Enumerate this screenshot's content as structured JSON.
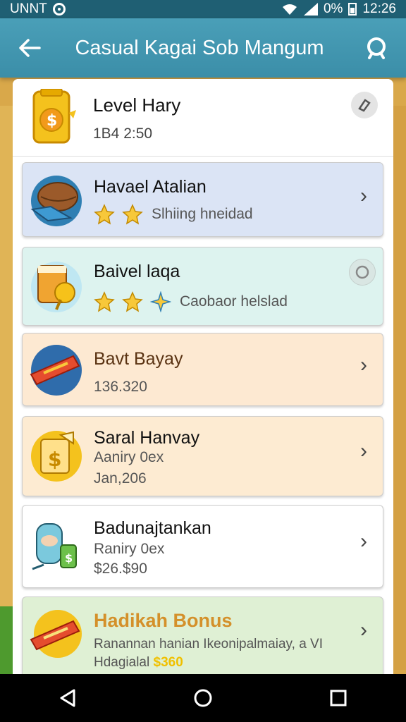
{
  "status": {
    "carrier": "UNNT",
    "battery": "0%",
    "time": "12:26"
  },
  "app_bar": {
    "title": "Casual Kagai Sob Mangum"
  },
  "header": {
    "title": "Level Hary",
    "subtitle": "1B4 2:50"
  },
  "cards": [
    {
      "title": "Havael Atalian",
      "sub": "Slhiing hneidad",
      "bg": "#dbe4f5"
    },
    {
      "title": "Baivel laqa",
      "sub": "Caobaor helslad",
      "bg": "#ddf3ef"
    },
    {
      "title": "Bavt Bayay",
      "sub": "136.320",
      "bg": "#fde9d2"
    },
    {
      "title": "Saral Hanvay",
      "sub": "Aaniry 0ex",
      "sub2": "Jan,206",
      "bg": "#fdebd2"
    },
    {
      "title": "Badunajtankan",
      "sub": "Raniry 0ex",
      "sub2": "$26.$90",
      "bg": "#ffffff"
    },
    {
      "title": "Hadikah Bonus",
      "sub": "Ranannan hanian Ikeonipalmaiay, a VI",
      "sub2": "Hdagialal",
      "badge": "$360",
      "bg": "#dff0d4"
    }
  ],
  "colors": {
    "status_bar": "#1f5f73",
    "app_bar": "#4a9fb8",
    "bonus_title": "#d4902a"
  }
}
